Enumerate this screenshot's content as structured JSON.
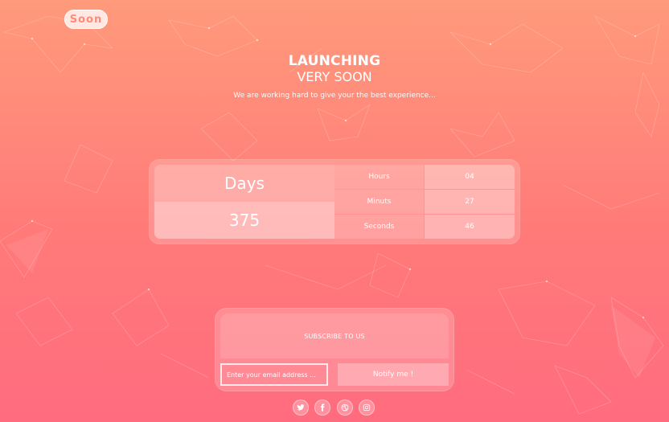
{
  "brand": {
    "logo_text": "Soon"
  },
  "headline": {
    "line1": "LAUNCHING",
    "line2": "VERY SOON",
    "tagline": "We are working hard to give your the best experience..."
  },
  "countdown": {
    "days_label": "Days",
    "days_value": "375",
    "rows": [
      {
        "label": "Hours",
        "value": "04"
      },
      {
        "label": "Minuts",
        "value": "27"
      },
      {
        "label": "Seconds",
        "value": "46"
      }
    ]
  },
  "subscribe": {
    "title": "SUBSCRIBE TO US",
    "email_placeholder": "Enter your email address ...",
    "email_value": "",
    "button_label": "Notify me !"
  },
  "social": [
    {
      "icon": "twitter-icon"
    },
    {
      "icon": "facebook-icon"
    },
    {
      "icon": "dribbble-icon"
    },
    {
      "icon": "instagram-icon"
    }
  ],
  "colors": {
    "gradient_top": "#ff9a7b",
    "gradient_bottom": "#ff6c7f",
    "text": "#ffffff"
  }
}
